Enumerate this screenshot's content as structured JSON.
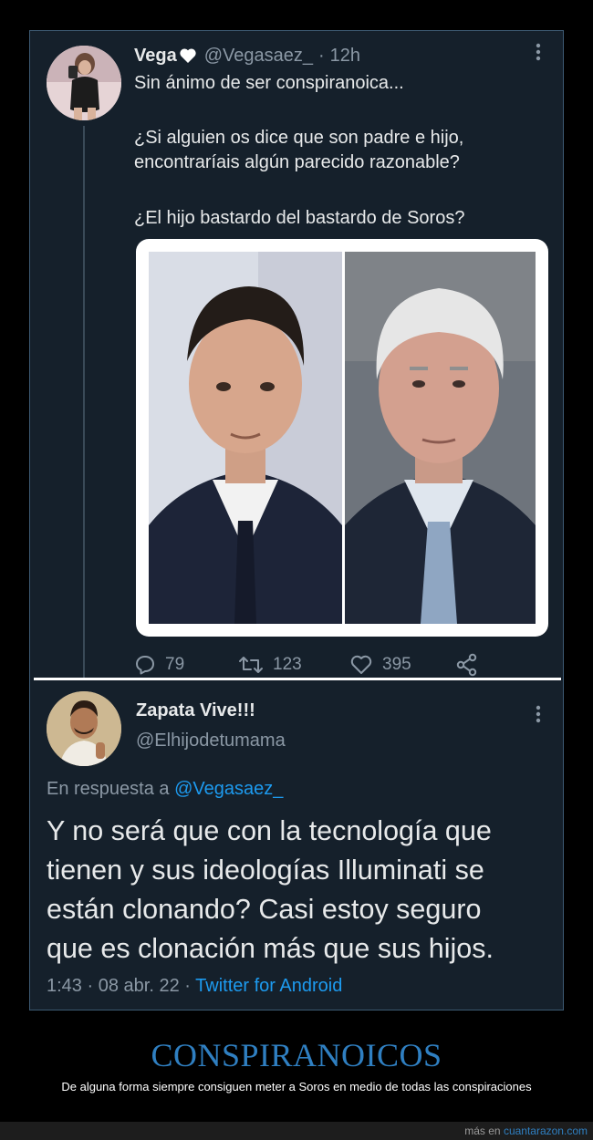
{
  "tweet1": {
    "author_name": "Vega",
    "handle": "@Vegasaez_",
    "separator": "·",
    "time": "12h",
    "lines": [
      "Sin ánimo de ser conspiranoica...",
      "¿Si alguien os dice que son padre e hijo,",
      "encontraríais algún parecido razonable?",
      "¿El hijo bastardo del bastardo de Soros?"
    ],
    "reply_count": "79",
    "retweet_count": "123",
    "like_count": "395",
    "icons": [
      "heart-badge-icon",
      "reply-icon",
      "retweet-icon",
      "like-icon",
      "share-icon",
      "more-icon"
    ]
  },
  "tweet2": {
    "author_name": "Zapata Vive!!!",
    "handle": "@Elhijodetumama",
    "reply_prefix": "En respuesta a",
    "reply_mention": "@Vegasaez_",
    "body_lines": [
      "Y no será que con la tecnología que",
      "tienen y sus ideologías Illuminati se",
      "están clonando? Casi estoy seguro",
      "que es clonación más que sus hijos."
    ],
    "time": "1:43",
    "date": "08 abr. 22",
    "sep": "·",
    "source": "Twitter for Android"
  },
  "caption": {
    "title": "CONSPIRANOICOS",
    "subtitle": "De alguna forma siempre consiguen meter a Soros en medio de todas las conspiraciones"
  },
  "footer": {
    "prefix": "más en",
    "site": "cuantarazon.com"
  },
  "colors": {
    "tweet_bg": "#15202b",
    "link": "#1d9bf0",
    "caption_title": "#2f7fc1",
    "muted": "#8b98a5"
  }
}
